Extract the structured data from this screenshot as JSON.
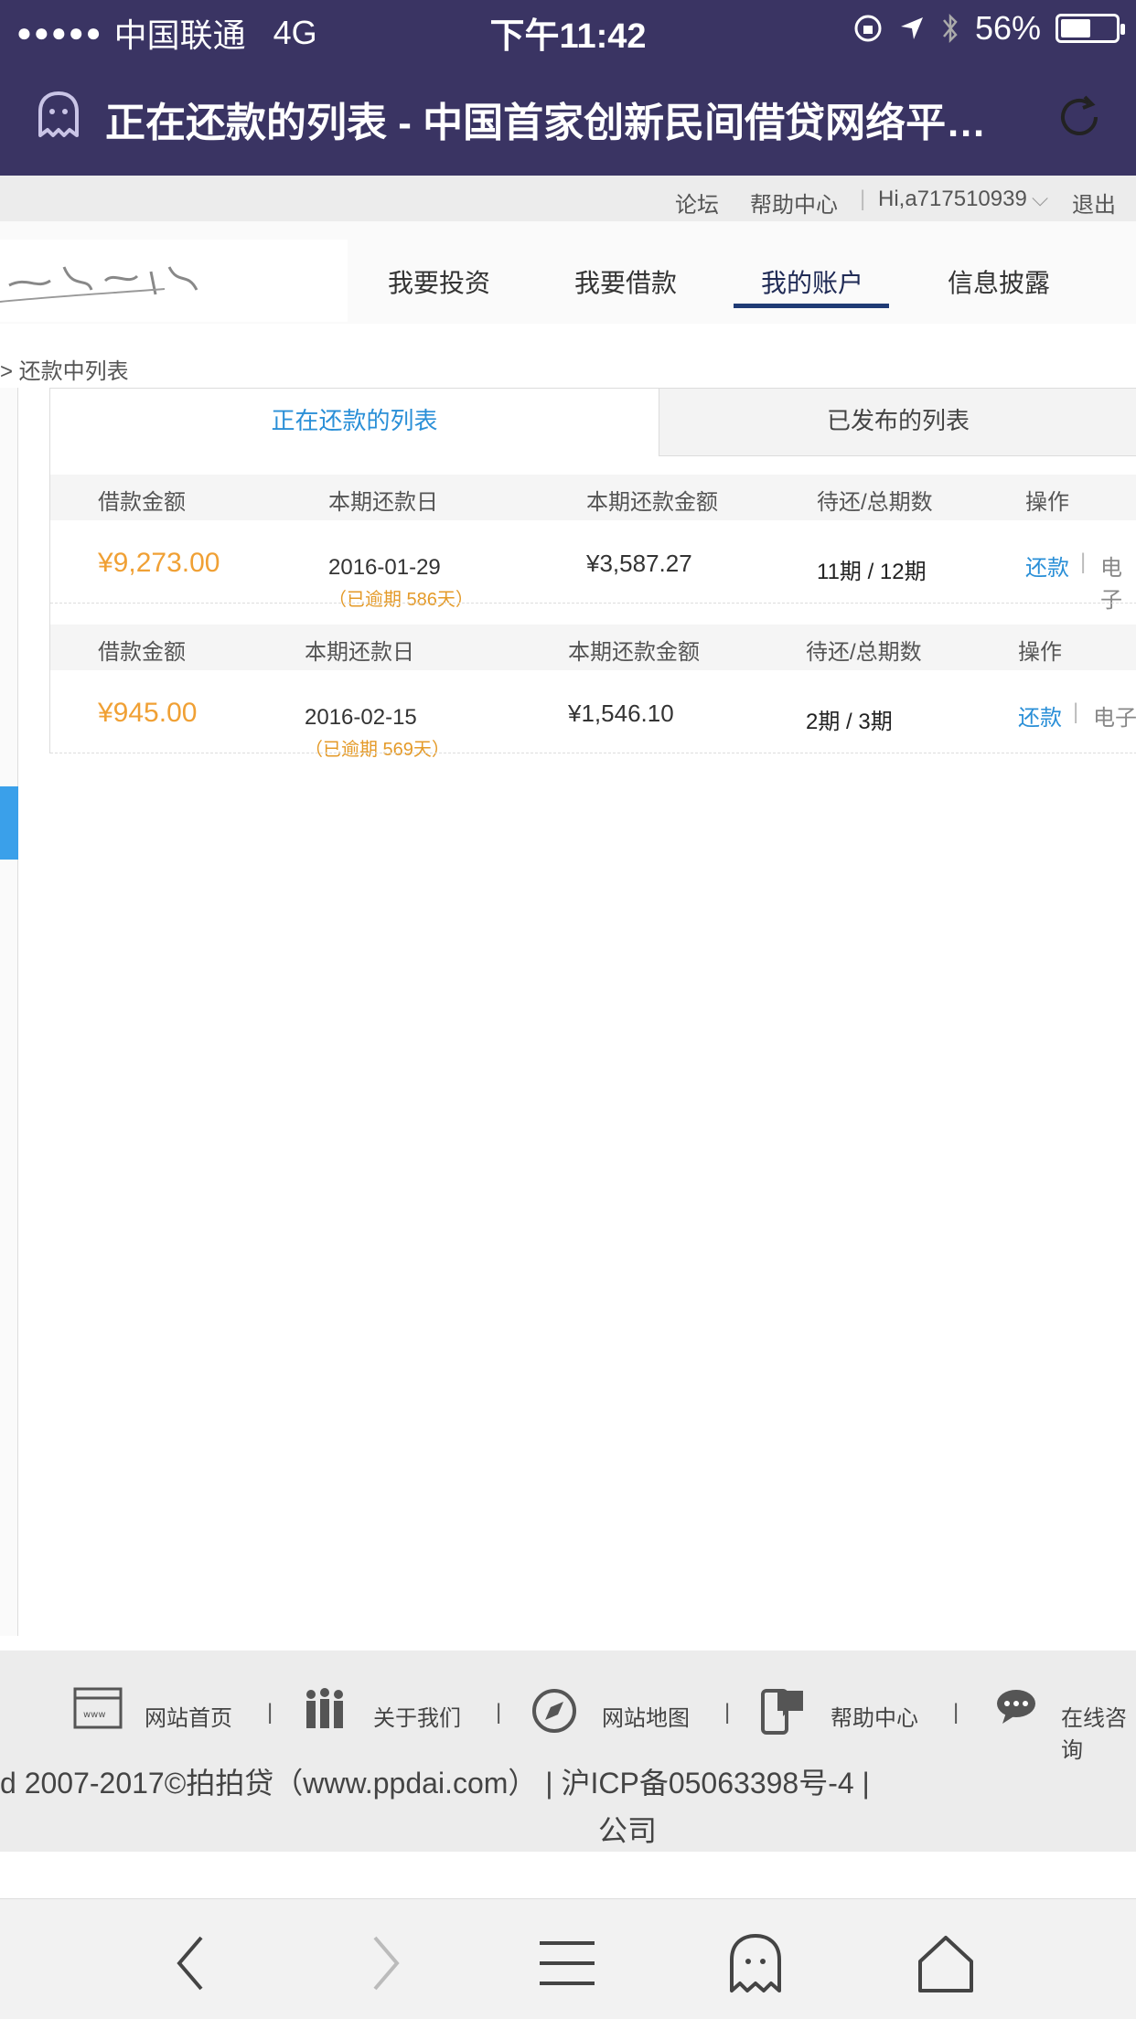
{
  "status": {
    "carrier": "中国联通",
    "network": "4G",
    "time": "下午11:42",
    "battery_text": "56%",
    "battery_level": 0.56
  },
  "titlebar": {
    "title": "正在还款的列表 - 中国首家创新民间借贷网络平…"
  },
  "toplinks": {
    "forum": "论坛",
    "help": "帮助中心",
    "user": "Hi,a717510939",
    "logout": "退出"
  },
  "nav": {
    "items": [
      "我要投资",
      "我要借款",
      "我的账户",
      "信息披露"
    ],
    "active_index": 2
  },
  "breadcrumb": {
    "text": "> 还款中列表"
  },
  "tabs": {
    "active": "正在还款的列表",
    "inactive": "已发布的列表"
  },
  "loans": [
    {
      "headers": [
        "借款金额",
        "本期还款日",
        "本期还款金额",
        "待还/总期数",
        "操作"
      ],
      "amount": "¥9,273.00",
      "due_date": "2016-01-29",
      "overdue": "（已逾期 586天）",
      "period_amount": "¥3,587.27",
      "periods": "11期 / 12期",
      "action": "还款",
      "contract": "电子"
    },
    {
      "headers": [
        "借款金额",
        "本期还款日",
        "本期还款金额",
        "待还/总期数",
        "操作"
      ],
      "amount": "¥945.00",
      "due_date": "2016-02-15",
      "overdue": "（已逾期 569天）",
      "period_amount": "¥1,546.10",
      "periods": "2期 / 3期",
      "action": "还款",
      "contract": "电子"
    }
  ],
  "footer": {
    "links": [
      "网站首页",
      "关于我们",
      "网站地图",
      "帮助中心",
      "在线咨询"
    ],
    "copyright": "d 2007-2017©拍拍贷（www.ppdai.com）   |    沪ICP备05063398号-4    |",
    "company": "公司"
  },
  "colors": {
    "header_bg": "#3a3463",
    "accent_blue": "#2a8fd7",
    "amount_orange": "#f0a034"
  }
}
